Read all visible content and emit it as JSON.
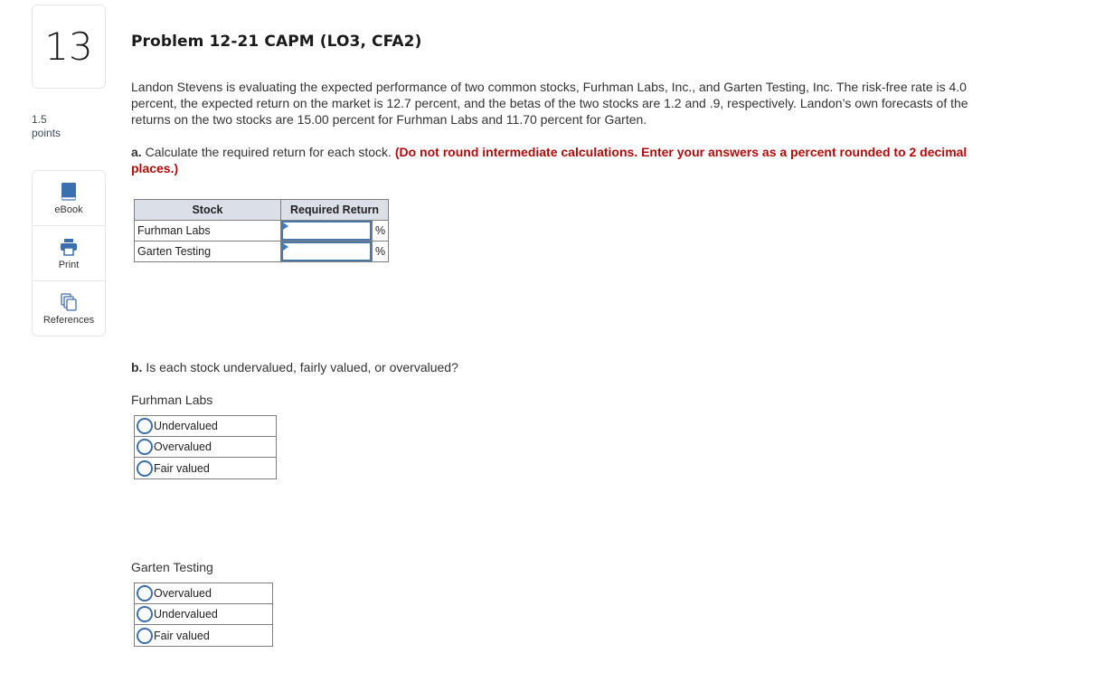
{
  "question": {
    "number": "13",
    "points_value": "1.5",
    "points_label": "points"
  },
  "tools": [
    {
      "label": "eBook",
      "icon": "book-icon"
    },
    {
      "label": "Print",
      "icon": "printer-icon"
    },
    {
      "label": "References",
      "icon": "documents-icon"
    }
  ],
  "problem": {
    "title": "Problem 12-21 CAPM (LO3, CFA2)",
    "intro": "Landon Stevens is evaluating the expected performance of two common stocks, Furhman Labs, Inc., and Garten Testing, Inc. The risk-free rate is 4.0 percent, the expected return on the market is 12.7 percent, and the betas of the two stocks are 1.2 and .9, respectively. Landon’s own forecasts of the returns on the two stocks are 15.00 percent for Furhman Labs and 11.70 percent for Garten."
  },
  "part_a": {
    "prefix": "a.",
    "text": " Calculate the required return for each stock. ",
    "instruction": "(Do not round intermediate calculations. Enter your answers as a percent rounded to 2 decimal places.)",
    "table": {
      "headers": [
        "Stock",
        "Required Return"
      ],
      "rows": [
        {
          "stock": "Furhman Labs",
          "value": "",
          "unit": "%"
        },
        {
          "stock": "Garten Testing",
          "value": "",
          "unit": "%"
        }
      ]
    }
  },
  "part_b": {
    "prefix": "b.",
    "text": " Is each stock undervalued, fairly valued, or overvalued?",
    "groups": [
      {
        "label": "Furhman Labs",
        "options": [
          "Undervalued",
          "Overvalued",
          "Fair valued"
        ],
        "selected": null
      },
      {
        "label": "Garten Testing",
        "options": [
          "Overvalued",
          "Undervalued",
          "Fair valued"
        ],
        "selected": null
      }
    ]
  },
  "colors": {
    "instruction_red": "#b20b0b",
    "accent_blue": "#3b6fb0",
    "header_bg": "#dbe0e8"
  }
}
